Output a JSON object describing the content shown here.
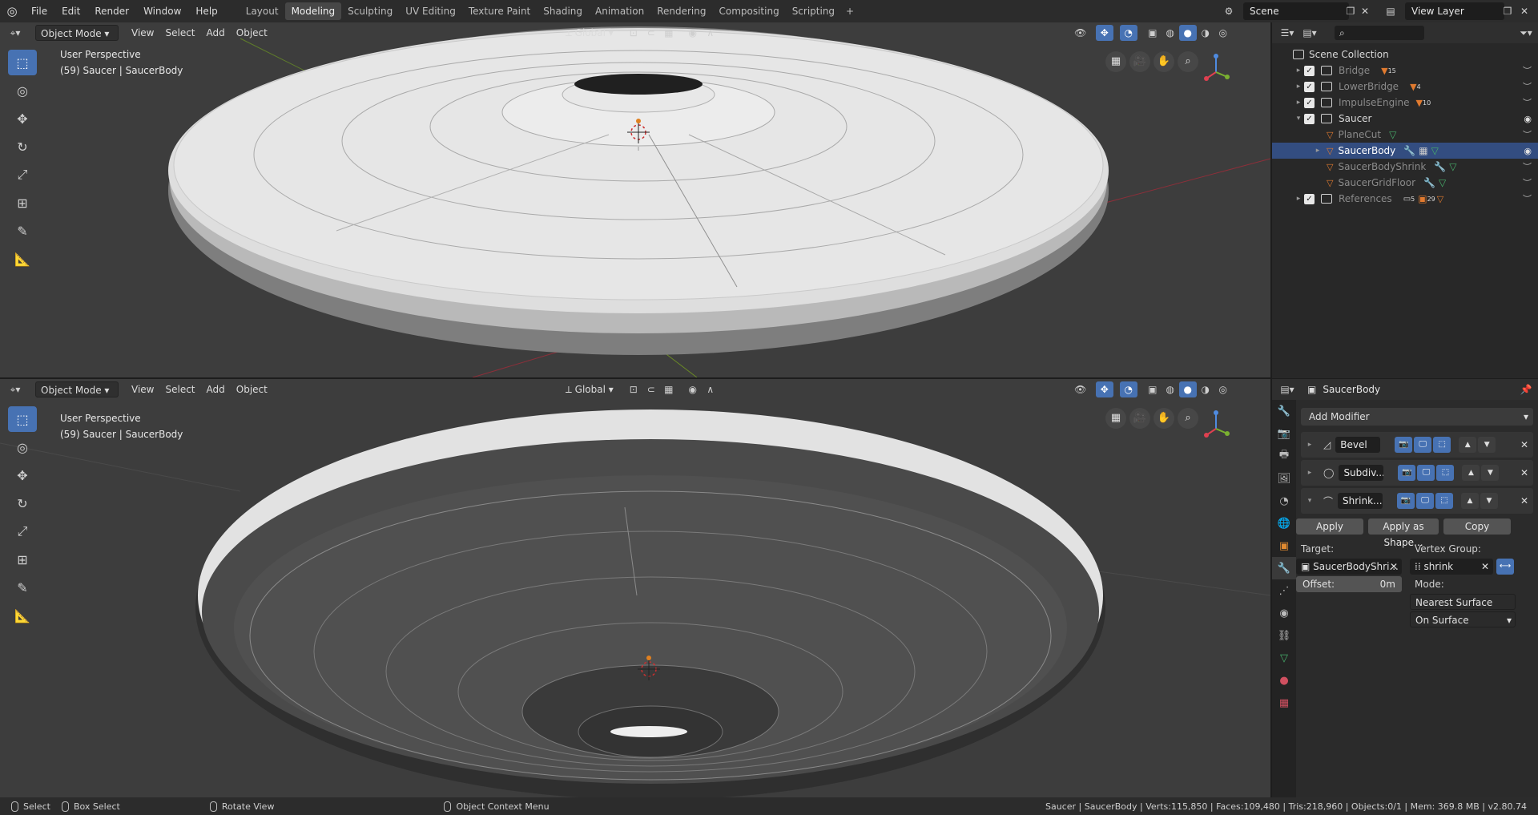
{
  "topbar": {
    "menus": [
      "File",
      "Edit",
      "Render",
      "Window",
      "Help"
    ],
    "workspaces": [
      "Layout",
      "Modeling",
      "Sculpting",
      "UV Editing",
      "Texture Paint",
      "Shading",
      "Animation",
      "Rendering",
      "Compositing",
      "Scripting"
    ],
    "active_workspace": "Modeling",
    "scene": "Scene",
    "view_layer": "View Layer"
  },
  "viewport_top": {
    "mode": "Object Mode",
    "menus": [
      "View",
      "Select",
      "Add",
      "Object"
    ],
    "orientation": "Global",
    "perspective": "User Perspective",
    "object_info": "(59) Saucer | SaucerBody"
  },
  "viewport_bottom": {
    "mode": "Object Mode",
    "menus": [
      "View",
      "Select",
      "Add",
      "Object"
    ],
    "orientation": "Global",
    "perspective": "User Perspective",
    "object_info": "(59) Saucer | SaucerBody"
  },
  "outliner": {
    "root": "Scene Collection",
    "items": [
      {
        "name": "Bridge",
        "badge": "15",
        "dim": true
      },
      {
        "name": "LowerBridge",
        "badge": "4",
        "dim": true
      },
      {
        "name": "ImpulseEngine",
        "badge": "10",
        "dim": true
      },
      {
        "name": "Saucer",
        "dim": false
      },
      {
        "name": "PlaneCut",
        "dim": true
      },
      {
        "name": "SaucerBody",
        "dim": false
      },
      {
        "name": "SaucerBodyShrink",
        "dim": true
      },
      {
        "name": "SaucerGridFloor",
        "dim": true
      },
      {
        "name": "References",
        "badge": "5",
        "badge2": "29",
        "dim": true
      }
    ]
  },
  "properties": {
    "object_name": "SaucerBody",
    "add_modifier": "Add Modifier",
    "modifiers": [
      {
        "name": "Bevel"
      },
      {
        "name": "Subdiv..."
      },
      {
        "name": "Shrink..."
      }
    ],
    "apply": "Apply",
    "apply_shape": "Apply as Shape...",
    "copy": "Copy",
    "target_label": "Target:",
    "target_value": "SaucerBodyShri...",
    "vgroup_label": "Vertex Group:",
    "vgroup_value": "shrink",
    "offset_label": "Offset:",
    "offset_value": "0m",
    "mode_label": "Mode:",
    "mode_value": "Nearest Surface Point",
    "onsurface": "On Surface"
  },
  "statusbar": {
    "select": "Select",
    "box_select": "Box Select",
    "rotate": "Rotate View",
    "context": "Object Context Menu",
    "stats": "Saucer | SaucerBody | Verts:115,850 | Faces:109,480 | Tris:218,960 | Objects:0/1 | Mem: 369.8 MB | v2.80.74"
  },
  "colors": {
    "accent": "#4772b3",
    "selected_row": "#334d80",
    "mesh": "#e07a2f"
  }
}
